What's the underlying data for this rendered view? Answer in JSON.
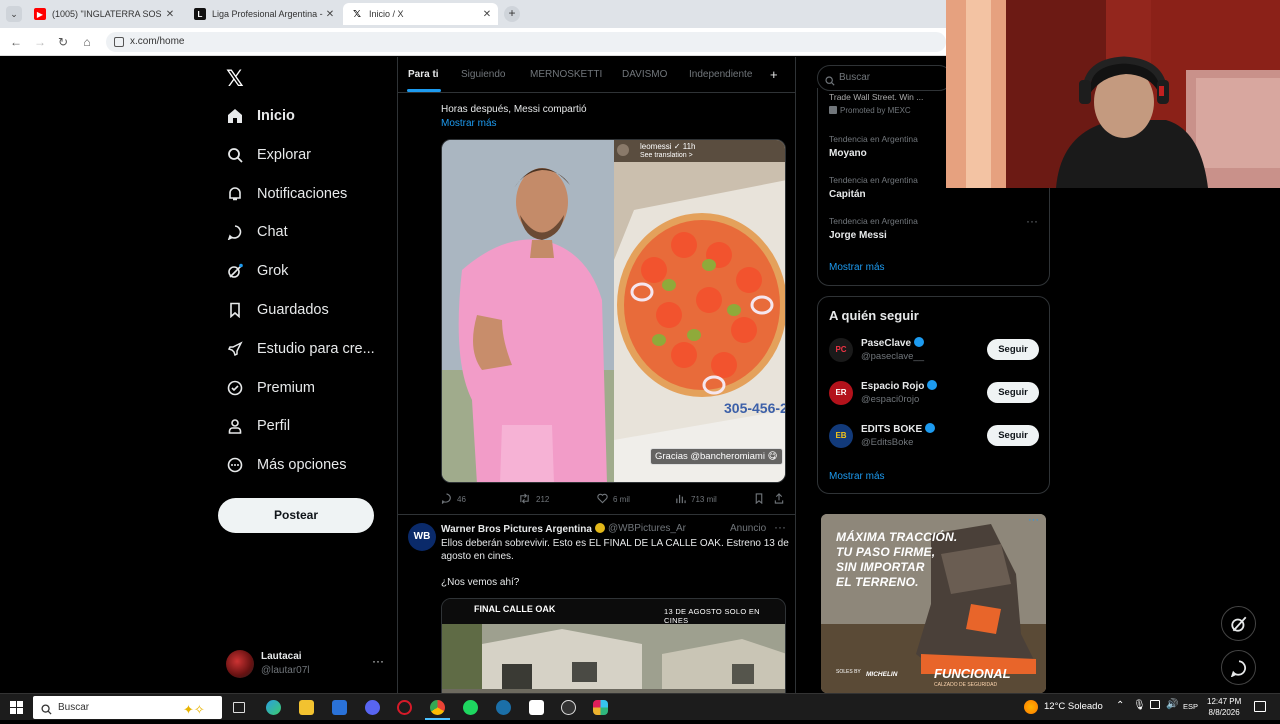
{
  "browser": {
    "tabs": [
      {
        "label": "(1005) \"INGLATERRA SOS CAGO",
        "favicon": "youtube-icon",
        "color": "#ff0000"
      },
      {
        "label": "Liga Profesional Argentina - Tab",
        "favicon": "lpf-icon",
        "color": "#111111"
      },
      {
        "label": "Inicio / X",
        "favicon": "x-icon",
        "color": "#000000"
      }
    ],
    "url": "x.com/home"
  },
  "sidebar": {
    "items": [
      {
        "label": "Inicio",
        "icon": "home-icon"
      },
      {
        "label": "Explorar",
        "icon": "search-icon"
      },
      {
        "label": "Notificaciones",
        "icon": "bell-icon"
      },
      {
        "label": "Chat",
        "icon": "chat-icon"
      },
      {
        "label": "Grok",
        "icon": "grok-icon"
      },
      {
        "label": "Guardados",
        "icon": "bookmark-icon"
      },
      {
        "label": "Estudio para cre...",
        "icon": "rocket-icon"
      },
      {
        "label": "Premium",
        "icon": "verified-icon"
      },
      {
        "label": "Perfil",
        "icon": "person-icon"
      },
      {
        "label": "Más opciones",
        "icon": "more-circle-icon"
      }
    ],
    "post_button": "Postear",
    "account": {
      "name": "Lautacai",
      "handle": "@lautar07l"
    }
  },
  "feed": {
    "tabs": [
      "Para ti",
      "Siguiendo",
      "MERNOSKETTI",
      "DAVISMO",
      "Independiente"
    ],
    "post1": {
      "text": "Horas después, Messi compartió",
      "show_more": "Mostrar más",
      "story_user": "leomessi ✓ 11h",
      "story_translate": "See translation >",
      "story_caption": "Gracias @bancheromiami 😋",
      "replies": "46",
      "reposts": "212",
      "likes": "6 mil",
      "views": "713 mil"
    },
    "post2": {
      "name": "Warner Bros Pictures Argentina",
      "handle": "@WBPictures_Ar",
      "ad_label": "Anuncio",
      "text": "Ellos deberán sobrevivir. Esto es EL FINAL DE LA CALLE OAK. Estreno 13 de agosto en cines.",
      "question": "¿Nos vemos ahí?",
      "media_title": "FINAL CALLE OAK",
      "media_date": "13 DE AGOSTO SOLO EN CINES"
    }
  },
  "right": {
    "search_placeholder": "Buscar",
    "promo_prev": "Trade Wall Street. Win ...",
    "promo": "Promoted by MEXC",
    "trends": [
      {
        "context": "Tendencia en Argentina",
        "name": "Moyano"
      },
      {
        "context": "Tendencia en Argentina",
        "name": "Capitán"
      },
      {
        "context": "Tendencia en Argentina",
        "name": "Jorge Messi"
      }
    ],
    "show_more": "Mostrar más",
    "who_to_follow": {
      "title": "A quién seguir",
      "accounts": [
        {
          "name": "PaseClave",
          "handle": "@paseclave__",
          "button": "Seguir",
          "avatar_color": "#1a1a1a"
        },
        {
          "name": "Espacio Rojo",
          "handle": "@espaci0rojo",
          "button": "Seguir",
          "avatar_color": "#b3121b"
        },
        {
          "name": "EDITS BOKE",
          "handle": "@EditsBoke",
          "button": "Seguir",
          "avatar_color": "#123a7a"
        }
      ],
      "show_more": "Mostrar más"
    },
    "ad": {
      "lines": [
        "MÁXIMA TRACCIÓN.",
        "TU PASO FIRME,",
        "SIN IMPORTAR",
        "EL TERRENO."
      ],
      "brand": "FUNCIONAL",
      "brand_sub": "CALZADO DE SEGURIDAD",
      "michelin": "MICHELIN",
      "soles": "SOLES BY"
    }
  },
  "taskbar": {
    "search": "Buscar",
    "weather": "12°C  Soleado",
    "lang": "ESP",
    "time": "12:47 PM",
    "date": "8/8/2026"
  }
}
